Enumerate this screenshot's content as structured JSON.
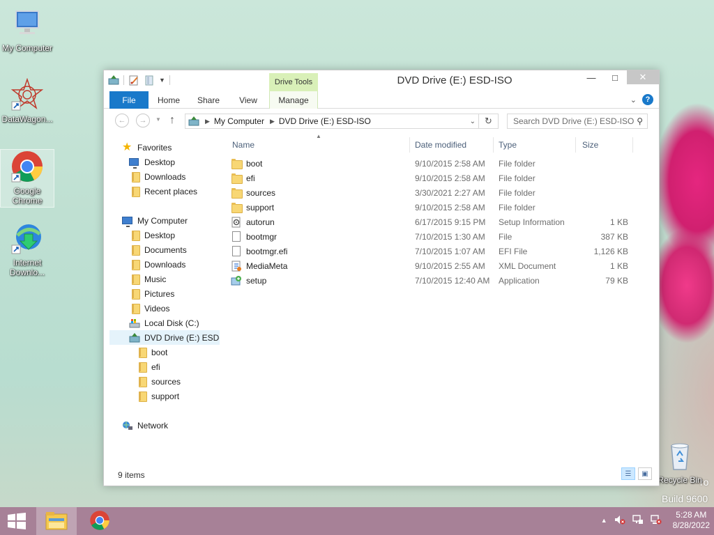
{
  "desktop": {
    "icons": [
      {
        "label": "My Computer"
      },
      {
        "label": "DataWagon..."
      },
      {
        "label": "Google Chrome"
      },
      {
        "label": "Internet Downlo..."
      },
      {
        "label": "Recycle Bin"
      }
    ],
    "watermark_partial": "ro",
    "build_text": "Build 9600"
  },
  "window": {
    "title": "DVD Drive (E:) ESD-ISO",
    "contextual_tab_group": "Drive Tools",
    "ribbon_tabs": [
      "File",
      "Home",
      "Share",
      "View",
      "Manage"
    ],
    "address": {
      "segments": [
        "My Computer",
        "DVD Drive (E:) ESD-ISO"
      ]
    },
    "search": {
      "placeholder": "Search DVD Drive (E:) ESD-ISO"
    },
    "nav": {
      "favorites": "Favorites",
      "favorites_items": [
        "Desktop",
        "Downloads",
        "Recent places"
      ],
      "computer": "My Computer",
      "computer_items": [
        "Desktop",
        "Documents",
        "Downloads",
        "Music",
        "Pictures",
        "Videos",
        "Local Disk (C:)",
        "DVD Drive (E:) ESD-ISO"
      ],
      "dvd_children": [
        "boot",
        "efi",
        "sources",
        "support"
      ],
      "network": "Network"
    },
    "columns": [
      "Name",
      "Date modified",
      "Type",
      "Size"
    ],
    "files": [
      {
        "name": "boot",
        "date": "9/10/2015 2:58 AM",
        "type": "File folder",
        "size": "",
        "icon": "folder-icon"
      },
      {
        "name": "efi",
        "date": "9/10/2015 2:58 AM",
        "type": "File folder",
        "size": "",
        "icon": "folder-icon"
      },
      {
        "name": "sources",
        "date": "3/30/2021 2:27 AM",
        "type": "File folder",
        "size": "",
        "icon": "folder-icon"
      },
      {
        "name": "support",
        "date": "9/10/2015 2:58 AM",
        "type": "File folder",
        "size": "",
        "icon": "folder-icon"
      },
      {
        "name": "autorun",
        "date": "6/17/2015 9:15 PM",
        "type": "Setup Information",
        "size": "1 KB",
        "icon": "settings-file-icon"
      },
      {
        "name": "bootmgr",
        "date": "7/10/2015 1:30 AM",
        "type": "File",
        "size": "387 KB",
        "icon": "file-icon"
      },
      {
        "name": "bootmgr.efi",
        "date": "7/10/2015 1:07 AM",
        "type": "EFI File",
        "size": "1,126 KB",
        "icon": "file-icon"
      },
      {
        "name": "MediaMeta",
        "date": "9/10/2015 2:55 AM",
        "type": "XML Document",
        "size": "1 KB",
        "icon": "xml-file-icon"
      },
      {
        "name": "setup",
        "date": "7/10/2015 12:40 AM",
        "type": "Application",
        "size": "79 KB",
        "icon": "setup-app-icon"
      }
    ],
    "status": "9 items"
  },
  "taskbar": {
    "time": "5:28 AM",
    "date": "8/28/2022"
  }
}
